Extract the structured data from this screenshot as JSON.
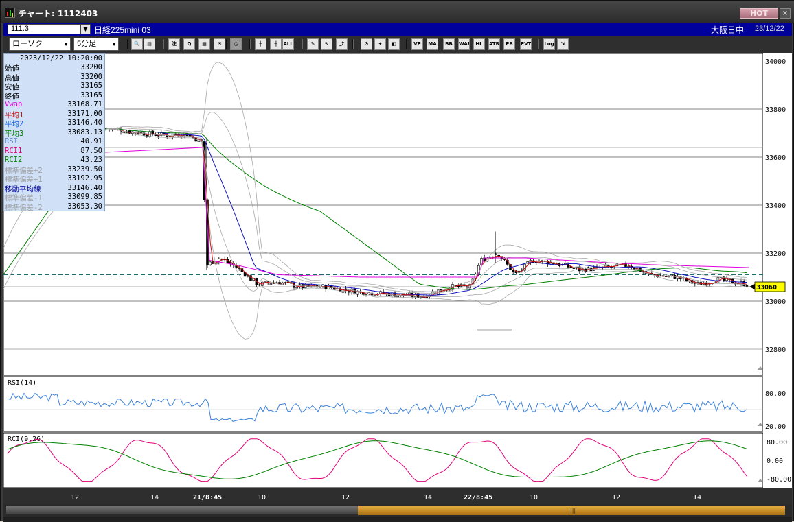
{
  "window": {
    "title": "チャート: 1112403",
    "hot_label": "HOT",
    "close_label": "×"
  },
  "infobar": {
    "code": "111.3",
    "instrument": "日経225mini 03",
    "market_status": "大阪日中",
    "date": "23/12/22"
  },
  "toolbar": {
    "chart_type": "ローソク",
    "timeframe": "5分足",
    "buttons": [
      {
        "name": "zoom-button",
        "icon": "magnifier-icon",
        "label": "🔍",
        "bg": "#e8e8e8"
      },
      {
        "name": "layout-button",
        "icon": "layout-icon",
        "label": "▤",
        "bg": "#e8e8e8"
      },
      {
        "name": "order-button",
        "icon": "order-icon",
        "label": "注",
        "bg": "#e8e8e8"
      },
      {
        "name": "search-chart-button",
        "icon": "search-chart-icon",
        "label": "Q",
        "bg": "#e8e8e8"
      },
      {
        "name": "chart-button",
        "icon": "chart-icon",
        "label": "▦",
        "bg": "#e8e8e8"
      },
      {
        "name": "alert-button",
        "icon": "alert-icon",
        "label": "✉",
        "bg": "#e8e8e8"
      },
      {
        "name": "clock-button",
        "icon": "clock-icon",
        "label": "◷",
        "bg": "#9a9a9a"
      },
      {
        "name": "candle-button",
        "icon": "candle-icon",
        "label": "┼",
        "bg": "#e8e8e8"
      },
      {
        "name": "candle-pair-button",
        "icon": "candle-pair-icon",
        "label": "╫",
        "bg": "#e8e8e8"
      },
      {
        "name": "all-button",
        "icon": "all-icon",
        "label": "ALL",
        "bg": "#e8e8e8"
      },
      {
        "name": "pen-button",
        "icon": "pen-icon",
        "label": "✎",
        "bg": "#e8e8e8"
      },
      {
        "name": "cursor-button",
        "icon": "cursor-icon",
        "label": "↖",
        "bg": "#e8e8e8"
      },
      {
        "name": "curve-button",
        "icon": "curve-icon",
        "label": "⤴",
        "bg": "#e8e8e8"
      },
      {
        "name": "settings-button",
        "icon": "gear-icon",
        "label": "⚙",
        "bg": "#e8e8e8"
      },
      {
        "name": "tool-button",
        "icon": "wrench-icon",
        "label": "✦",
        "bg": "#e8e8e8"
      },
      {
        "name": "color-button",
        "icon": "palette-icon",
        "label": "◧",
        "bg": "#e8e8e8"
      },
      {
        "name": "vp-button",
        "icon": "vp-icon",
        "label": "VP",
        "bg": "#e8e8e8"
      },
      {
        "name": "ma-button",
        "icon": "ma-icon",
        "label": "MA",
        "bg": "#e8e8e8"
      },
      {
        "name": "bb-button",
        "icon": "bb-icon",
        "label": "BB",
        "bg": "#e8e8e8"
      },
      {
        "name": "wae-button",
        "icon": "wae-icon",
        "label": "WAE",
        "bg": "#e8e8e8"
      },
      {
        "name": "hl-button",
        "icon": "hl-icon",
        "label": "HL",
        "bg": "#e8e8e8"
      },
      {
        "name": "atr-button",
        "icon": "atr-icon",
        "label": "ATR",
        "bg": "#e8e8e8"
      },
      {
        "name": "pb-button",
        "icon": "pb-icon",
        "label": "PB",
        "bg": "#e8e8e8"
      },
      {
        "name": "pvt-button",
        "icon": "pvt-icon",
        "label": "PVT",
        "bg": "#e8e8e8"
      },
      {
        "name": "log-button",
        "icon": "log-icon",
        "label": "Log",
        "bg": "#e8e8e8"
      },
      {
        "name": "export-button",
        "icon": "export-icon",
        "label": "⇲",
        "bg": "#e8e8e8"
      }
    ]
  },
  "ohlc_panel": {
    "date": "2023/12/22  10:20:00",
    "rows": [
      {
        "label": "始値",
        "value": "33200",
        "color": "#000000"
      },
      {
        "label": "高値",
        "value": "33200",
        "color": "#000000"
      },
      {
        "label": "安値",
        "value": "33165",
        "color": "#000000"
      },
      {
        "label": "終値",
        "value": "33165",
        "color": "#000000"
      },
      {
        "label": "Vwap",
        "value": "33168.71",
        "color": "#e000e0"
      },
      {
        "label": "平均1",
        "value": "33171.00",
        "color": "#d01010"
      },
      {
        "label": "平均2",
        "value": "33146.40",
        "color": "#1060e0"
      },
      {
        "label": "平均3",
        "value": "33083.13",
        "color": "#008000"
      },
      {
        "label": "RSI",
        "value": "40.91",
        "color": "#5a8ad0"
      },
      {
        "label": "RCI1",
        "value": "87.50",
        "color": "#e0007a"
      },
      {
        "label": "RCI2",
        "value": "43.23",
        "color": "#008000"
      },
      {
        "label": "標準偏差+2",
        "value": "33239.50",
        "color": "#a0a0a0"
      },
      {
        "label": "標準偏差+1",
        "value": "33192.95",
        "color": "#a0a0a0"
      },
      {
        "label": "移動平均線",
        "value": "33146.40",
        "color": "#0000a0"
      },
      {
        "label": "標準偏差-1",
        "value": "33099.85",
        "color": "#a0a0a0"
      },
      {
        "label": "標準偏差-2",
        "value": "33053.30",
        "color": "#a0a0a0"
      }
    ]
  },
  "main_chart": {
    "price_ticks": [
      "34000",
      "33800",
      "33600",
      "33400",
      "33200",
      "33000",
      "32800"
    ],
    "current_price": "33060",
    "dashed_line_price": 33110,
    "colors": {
      "vwap": "#e000e0",
      "ma1": "#d01010",
      "ma2": "#1010c0",
      "ma3": "#008000",
      "bb": "#a8a8a8",
      "candle": "#000000"
    }
  },
  "rsi_panel": {
    "title": "RSI(14)",
    "ticks": [
      "80.00",
      "20.00"
    ],
    "color": "#3a80d8"
  },
  "rci_panel": {
    "title": "RCI(9,26)",
    "ticks": [
      "80.00",
      "0.00",
      "-80.00"
    ],
    "colors": {
      "rci1": "#e0007a",
      "rci2": "#008000"
    }
  },
  "time_axis": {
    "labels": [
      {
        "text": "12",
        "bold": false
      },
      {
        "text": "14",
        "bold": false
      },
      {
        "text": "21/8:45",
        "bold": true
      },
      {
        "text": "10",
        "bold": false
      },
      {
        "text": "12",
        "bold": false
      },
      {
        "text": "14",
        "bold": false
      },
      {
        "text": "22/8:45",
        "bold": true
      },
      {
        "text": "10",
        "bold": false
      },
      {
        "text": "12",
        "bold": false
      },
      {
        "text": "14",
        "bold": false
      }
    ]
  },
  "scrollbar": {
    "grip": "|||"
  }
}
